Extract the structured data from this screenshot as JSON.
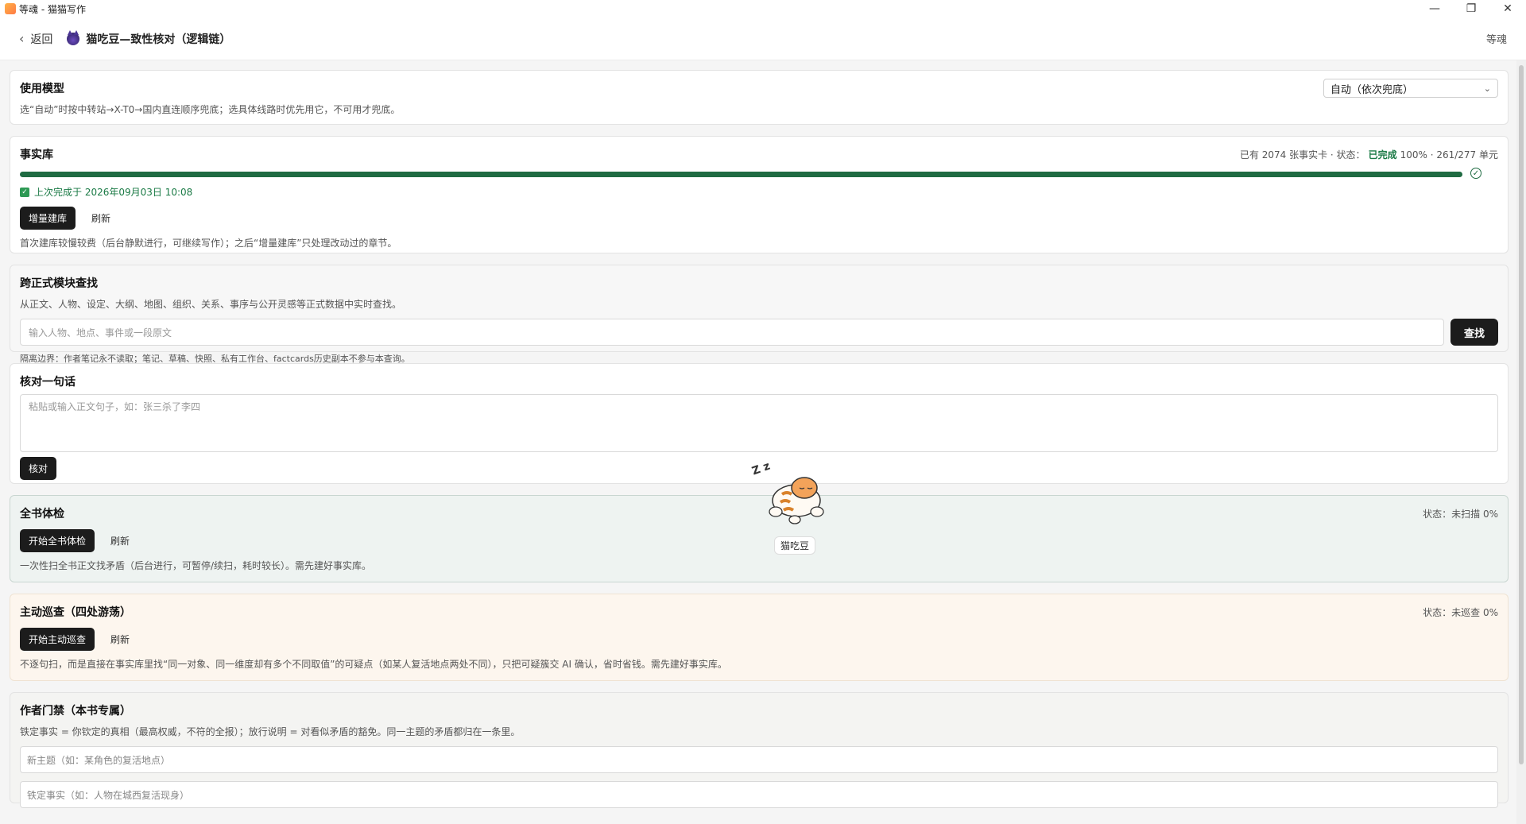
{
  "window": {
    "title": "等魂 - 猫猫写作",
    "minimize": "—",
    "maximize": "❐",
    "close": "✕"
  },
  "nav": {
    "back_label": "返回",
    "page_title": "猫吃豆—致性核对（逻辑链）",
    "right_label": "等魂"
  },
  "model": {
    "title": "使用模型",
    "desc": "选“自动”时按中转站→X-T0→国内直连顺序兜底；选具体线路时优先用它，不可用才兜底。",
    "selected": "自动（依次兜底）"
  },
  "facts": {
    "title": "事实库",
    "status_prefix": "已有 2074 张事实卡 · 状态：",
    "status_done": "已完成",
    "status_suffix": "100% · 261/277 单元",
    "progress": 100,
    "last_done": "上次完成于 2026年09月03日 10:08",
    "btn_incremental": "增量建库",
    "btn_refresh": "刷新",
    "desc": "首次建库较慢较费（后台静默进行，可继续写作）；之后“增量建库”只处理改动过的章节。"
  },
  "search": {
    "title": "跨正式模块查找",
    "desc": "从正文、人物、设定、大纲、地图、组织、关系、事序与公开灵感等正式数据中实时查找。",
    "placeholder": "输入人物、地点、事件或一段原文",
    "btn": "查找",
    "note": "隔离边界：作者笔记永不读取；笔记、草稿、快照、私有工作台、factcards历史副本不参与本查询。"
  },
  "check": {
    "title": "核对一句话",
    "placeholder": "粘贴或输入正文句子，如：张三杀了李四",
    "btn": "核对"
  },
  "whole": {
    "title": "全书体检",
    "state": "状态：未扫描 0%",
    "btn_start": "开始全书体检",
    "btn_refresh": "刷新",
    "desc": "一次性扫全书正文找矛盾（后台进行，可暂停/续扫，耗时较长）。需先建好事实库。"
  },
  "patrol": {
    "title": "主动巡查（四处游荡）",
    "state": "状态：未巡查 0%",
    "btn_start": "开始主动巡查",
    "btn_refresh": "刷新",
    "desc": "不逐句扫，而是直接在事实库里找“同一对象、同一维度却有多个不同取值”的可疑点（如某人复活地点两处不同），只把可疑簇交 AI 确认，省时省钱。需先建好事实库。"
  },
  "gate": {
    "title": "作者门禁（本书专属）",
    "desc": "铁定事实 = 你钦定的真相（最高权威，不符的全报）；放行说明 = 对看似矛盾的豁免。同一主题的矛盾都归在一条里。",
    "topic_placeholder": "新主题（如：某角色的复活地点）",
    "fact_placeholder": "铁定事实（如：人物在城西复活现身）"
  },
  "mascot": {
    "label": "猫吃豆",
    "zz": "Z z"
  }
}
